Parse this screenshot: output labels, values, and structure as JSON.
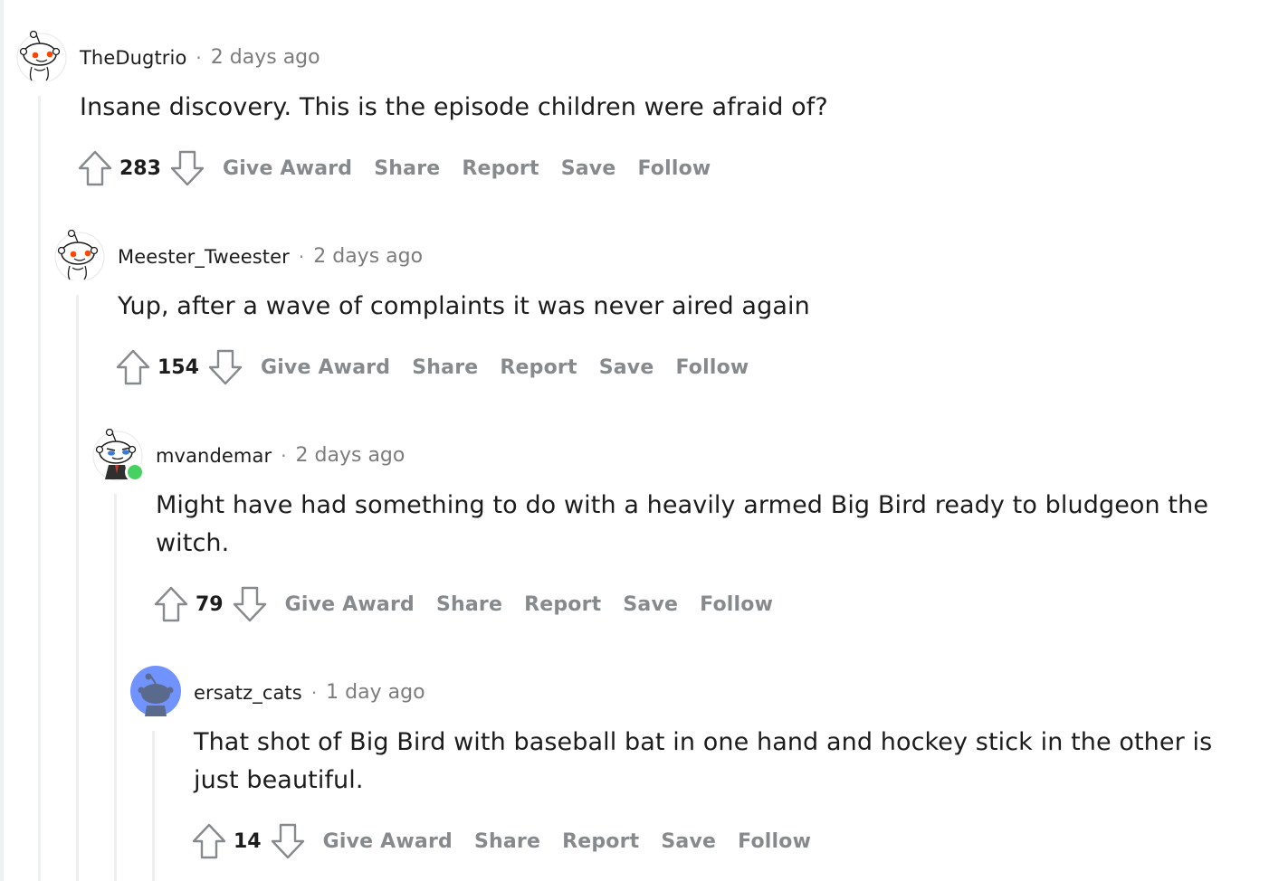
{
  "comments": [
    {
      "author": "TheDugtrio",
      "dot": "·",
      "time": "2 days ago",
      "text": "Insane discovery. This is the episode children were afraid of?",
      "score": "283",
      "actions": [
        "Give Award",
        "Share",
        "Report",
        "Save",
        "Follow"
      ],
      "avatar": "default-snoo-red-eyes"
    },
    {
      "author": "Meester_Tweester",
      "dot": "·",
      "time": "2 days ago",
      "text": "Yup, after a wave of complaints it was never aired again",
      "score": "154",
      "actions": [
        "Give Award",
        "Share",
        "Report",
        "Save",
        "Follow"
      ],
      "avatar": "default-snoo-red-eyes"
    },
    {
      "author": "mvandemar",
      "dot": "·",
      "time": "2 days ago",
      "text": "Might have had something to do with a heavily armed Big Bird ready to bludgeon the witch.",
      "score": "79",
      "actions": [
        "Give Award",
        "Share",
        "Report",
        "Save",
        "Follow"
      ],
      "avatar": "custom-snoo-blue-eyes-suit",
      "online": true
    },
    {
      "author": "ersatz_cats",
      "dot": "·",
      "time": "1 day ago",
      "text": "That shot of Big Bird with baseball bat in one hand and hockey stick in the other is just beautiful.",
      "score": "14",
      "actions": [
        "Give Award",
        "Share",
        "Report",
        "Save",
        "Follow"
      ],
      "avatar": "blue-circle-snoo"
    }
  ],
  "colors": {
    "meta_gray": "#7c7c7c",
    "action_gray": "#878a8c",
    "thread_line": "#edeff1",
    "online_green": "#46d160",
    "avatar_blue_bg": "#7193ff",
    "snoo_orange": "#ff4500"
  }
}
